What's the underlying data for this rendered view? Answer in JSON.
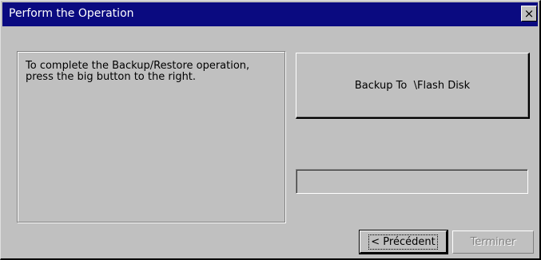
{
  "window": {
    "title": "Perform the Operation",
    "close_label": "×"
  },
  "info": {
    "text": "To complete the Backup/Restore operation, press the big button to the right."
  },
  "action": {
    "button_label": "Backup To  \\Flash Disk"
  },
  "progress": {
    "value": 0
  },
  "footer": {
    "prev_label": "< Précédent",
    "finish_label": "Terminer"
  },
  "colors": {
    "titlebar": "#0a0a80",
    "face": "#c0c0c0",
    "disabled_text": "#808080"
  }
}
